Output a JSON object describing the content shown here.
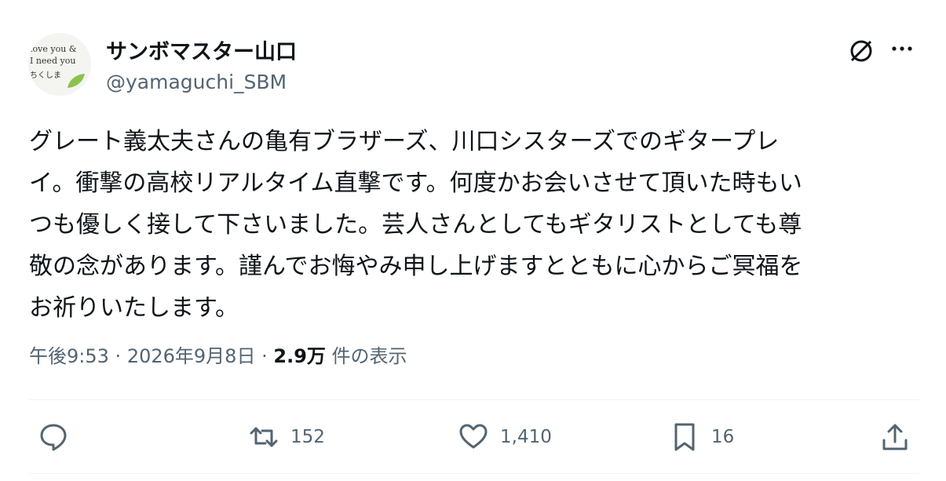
{
  "author": {
    "display_name": "サンボマスター山口",
    "handle": "@yamaguchi_SBM",
    "avatar_lines": [
      "love you &",
      "I need you",
      "ちくしま"
    ]
  },
  "post": {
    "lines": [
      "グレート義太夫さんの亀有ブラザーズ、川口シスターズでのギタープレ",
      "イ。衝撃の高校リアルタイム直撃です。何度かお会いさせて頂いた時もい",
      "つも優しく接して下さいました。芸人さんとしてもギタリストとしても尊",
      "敬の念があります。謹んでお悔やみ申し上げますとともに心からご冥福を",
      "お祈りいたします。"
    ]
  },
  "meta": {
    "time": "午後9:53",
    "date": "2026年9月8日",
    "separator": "·",
    "views_count": "2.9万",
    "views_label": "件の表示"
  },
  "actions": {
    "retweets": "152",
    "likes": "1,410",
    "bookmarks": "16"
  },
  "icons": [
    "grok-icon",
    "more-icon",
    "reply-icon",
    "retweet-icon",
    "like-icon",
    "bookmark-icon",
    "share-icon"
  ],
  "colors": {
    "text": "#0f1419",
    "secondary": "#536471",
    "divider": "#eff3f4"
  }
}
